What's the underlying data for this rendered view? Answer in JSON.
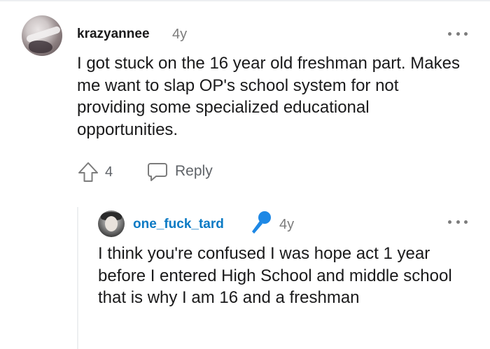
{
  "comment": {
    "username": "krazyannee",
    "age": "4y",
    "text": "I got stuck on the 16 year old freshman part. Makes me want to slap OP's school system for not providing some specialized educational opportunities.",
    "vote_count": "4",
    "reply_label": "Reply"
  },
  "reply": {
    "username": "one_fuck_tard",
    "age": "4y",
    "text": "I think you're confused I was hope act 1 year before I entered High School and middle school that is why I am 16 and a freshman"
  },
  "colors": {
    "username_reply": "#0a7ac4",
    "mic_badge": "#1e88e5",
    "muted": "#7c7c7c"
  },
  "icons": {
    "upvote": "arrow-up-icon",
    "reply": "speech-bubble-icon",
    "more": "more-options-icon",
    "badge": "microphone-icon"
  }
}
